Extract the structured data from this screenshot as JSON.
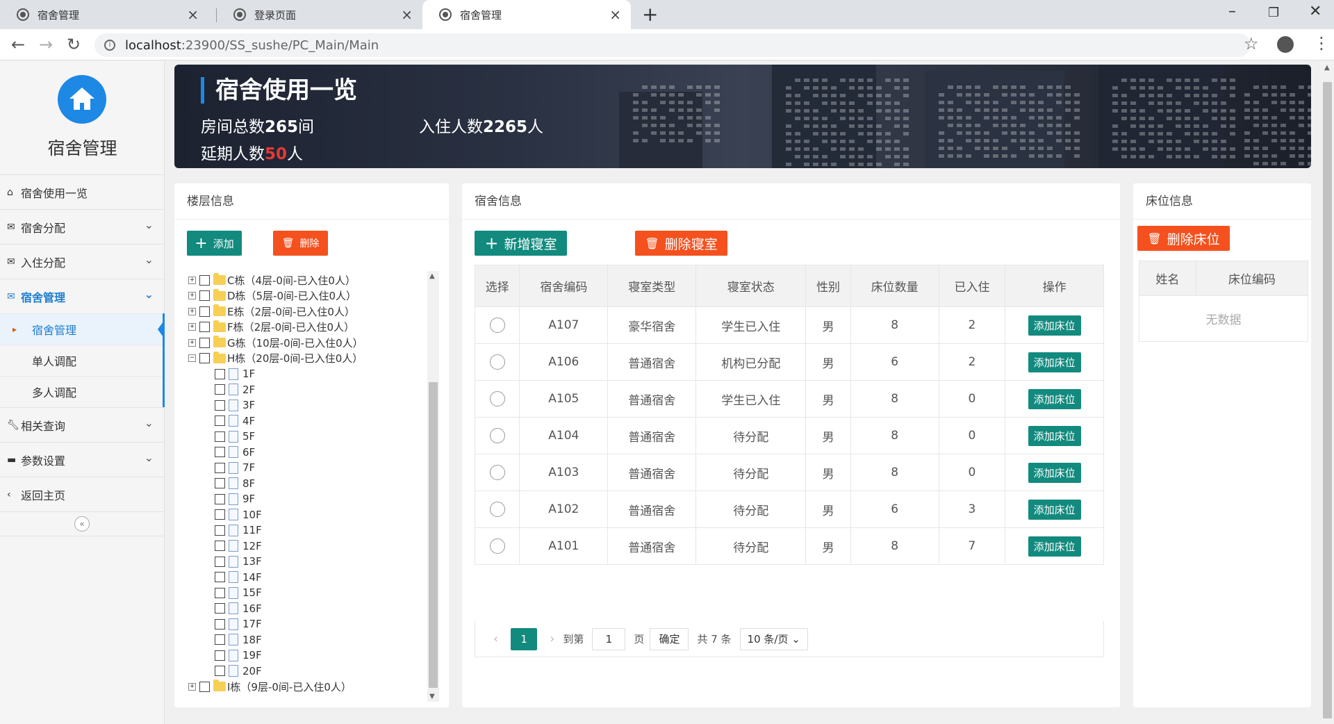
{
  "browser": {
    "tabs": [
      {
        "title": "宿舍管理"
      },
      {
        "title": "登录页面"
      },
      {
        "title": "宿舍管理"
      }
    ],
    "url_host": "localhost",
    "url_path": ":23900/SS_sushe/PC_Main/Main"
  },
  "sidebar": {
    "app_name": "宿舍管理",
    "items": [
      {
        "label": "宿舍使用一览",
        "icon": "home-icon"
      },
      {
        "label": "宿舍分配",
        "icon": "envelope-icon"
      },
      {
        "label": "入住分配",
        "icon": "envelope-icon"
      },
      {
        "label": "宿舍管理",
        "icon": "envelope-icon"
      },
      {
        "label": "相关查询",
        "icon": "wrench-icon"
      },
      {
        "label": "参数设置",
        "icon": "briefcase-icon"
      },
      {
        "label": "返回主页",
        "icon": "chevron-left-icon"
      }
    ],
    "subitems": [
      {
        "label": "宿舍管理"
      },
      {
        "label": "单人调配"
      },
      {
        "label": "多人调配"
      }
    ]
  },
  "banner": {
    "title": "宿舍使用一览",
    "rooms_prefix": "房间总数",
    "rooms_value": "265",
    "rooms_suffix": "间",
    "residents_prefix": "入住人数",
    "residents_value": "2265",
    "residents_suffix": "人",
    "overdue_prefix": "延期人数",
    "overdue_value": "50",
    "overdue_suffix": "人"
  },
  "floor_panel": {
    "title": "楼层信息",
    "add_label": "添加",
    "delete_label": "删除",
    "buildings_top": [
      "C栋（4层-0间-已入住0人）",
      "D栋（5层-0间-已入住0人）",
      "E栋（2层-0间-已入住0人）",
      "F栋（2层-0间-已入住0人）",
      "G栋（10层-0间-已入住0人）",
      "H栋（20层-0间-已入住0人）"
    ],
    "floors": [
      "1F",
      "2F",
      "3F",
      "4F",
      "5F",
      "6F",
      "7F",
      "8F",
      "9F",
      "10F",
      "11F",
      "12F",
      "13F",
      "14F",
      "15F",
      "16F",
      "17F",
      "18F",
      "19F",
      "20F"
    ],
    "buildings_bottom": [
      "I栋（9层-0间-已入住0人）"
    ]
  },
  "dorm_panel": {
    "title": "宿舍信息",
    "add_label": "新增寝室",
    "delete_label": "删除寝室",
    "columns": [
      "选择",
      "宿舍编码",
      "寝室类型",
      "寝室状态",
      "性别",
      "床位数量",
      "已入住",
      "操作"
    ],
    "rows": [
      {
        "code": "A107",
        "type": "豪华宿舍",
        "status": "学生已入住",
        "gender": "男",
        "beds": "8",
        "occupied": "2",
        "action": "添加床位"
      },
      {
        "code": "A106",
        "type": "普通宿舍",
        "status": "机构已分配",
        "gender": "男",
        "beds": "6",
        "occupied": "2",
        "action": "添加床位"
      },
      {
        "code": "A105",
        "type": "普通宿舍",
        "status": "学生已入住",
        "gender": "男",
        "beds": "8",
        "occupied": "0",
        "action": "添加床位"
      },
      {
        "code": "A104",
        "type": "普通宿舍",
        "status": "待分配",
        "gender": "男",
        "beds": "8",
        "occupied": "0",
        "action": "添加床位"
      },
      {
        "code": "A103",
        "type": "普通宿舍",
        "status": "待分配",
        "gender": "男",
        "beds": "8",
        "occupied": "0",
        "action": "添加床位"
      },
      {
        "code": "A102",
        "type": "普通宿舍",
        "status": "待分配",
        "gender": "男",
        "beds": "6",
        "occupied": "3",
        "action": "添加床位"
      },
      {
        "code": "A101",
        "type": "普通宿舍",
        "status": "待分配",
        "gender": "男",
        "beds": "8",
        "occupied": "7",
        "action": "添加床位"
      }
    ],
    "pager": {
      "current_page": "1",
      "goto_label": "到第",
      "goto_value": "1",
      "page_label": "页",
      "confirm_label": "确定",
      "total_label": "共 7 条",
      "page_size": "10 条/页"
    }
  },
  "bed_panel": {
    "title": "床位信息",
    "delete_label": "删除床位",
    "columns": [
      "姓名",
      "床位编码"
    ],
    "empty_text": "无数据"
  },
  "colors": {
    "primary": "#1e88e5",
    "teal": "#128a7e",
    "orange": "#f4511e",
    "red": "#e53935"
  }
}
